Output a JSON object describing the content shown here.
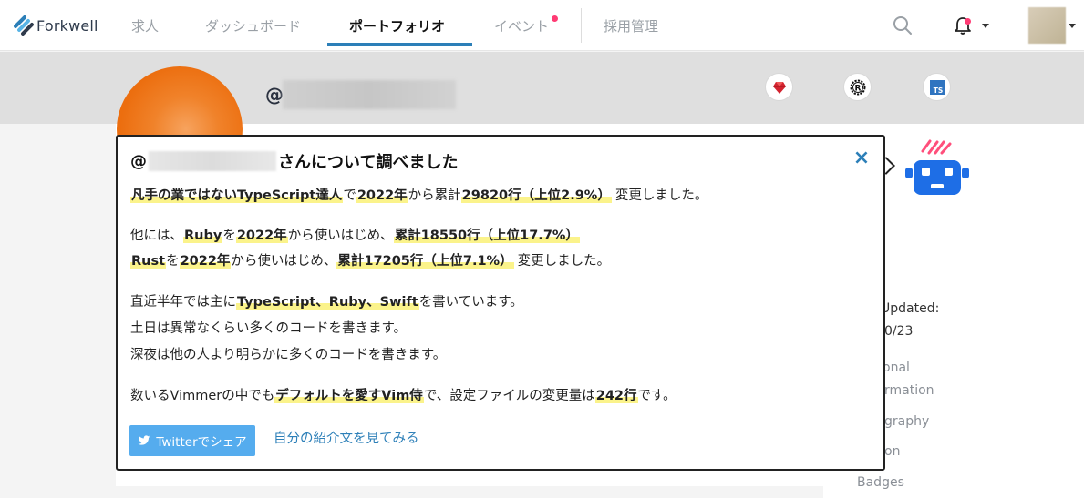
{
  "nav": {
    "brand": "Forkwell",
    "items": [
      {
        "label": "求人"
      },
      {
        "label": "ダッシュボード"
      },
      {
        "label": "ポートフォリオ"
      },
      {
        "label": "イベント"
      },
      {
        "label": "採用管理"
      }
    ],
    "active_index": 2
  },
  "profile": {
    "at_prefix": "@",
    "languages": [
      "ruby-icon",
      "rust-icon",
      "typescript-icon"
    ],
    "ts_label": "TS"
  },
  "side": {
    "updated_label": "Updated:",
    "updated_value": "0/23",
    "links": [
      "onal",
      "rmation",
      "graphy",
      "on",
      "Badges"
    ]
  },
  "popup": {
    "title_prefix": "@",
    "title_suffix": "さんについて調べました",
    "close_symbol": "×",
    "line1": {
      "a": "凡手の業ではないTypeScript達人",
      "b": "で",
      "c": "2022年",
      "d": "から累計",
      "e": "29820行（上位2.9%）",
      "f": "変更しました。"
    },
    "line2": {
      "a": "他には、",
      "b": "Ruby",
      "c": "を",
      "d": "2022年",
      "e": "から使いはじめ、",
      "f": "累計18550行（上位17.7%）"
    },
    "line3": {
      "a": "Rust",
      "b": "を",
      "c": "2022年",
      "d": "から使いはじめ、",
      "e": "累計17205行（上位7.1%）",
      "f": "変更しました。"
    },
    "line4": {
      "a": "直近半年では主に",
      "b": "TypeScript、Ruby、Swift",
      "c": "を書いています。"
    },
    "line5": "土日は異常なくらい多くのコードを書きます。",
    "line6": "深夜は他の人より明らかに多くのコードを書きます。",
    "line7": {
      "a": "数いるVimmerの中でも",
      "b": "デフォルトを愛すVim侍",
      "c": "で、設定ファイルの変更量は",
      "d": "242行",
      "e": "です。"
    },
    "twitter_button": "Twitterでシェア",
    "intro_link": "自分の紹介文を見てみる"
  },
  "colors": {
    "accent": "#2c7fb8",
    "highlight": "#fbf38b",
    "twitter": "#55acee",
    "notification": "#ff3b74",
    "avatar_orange": "#ec6e0f",
    "robot_blue": "#1e6ee6",
    "robot_pink": "#ff4f7b"
  }
}
